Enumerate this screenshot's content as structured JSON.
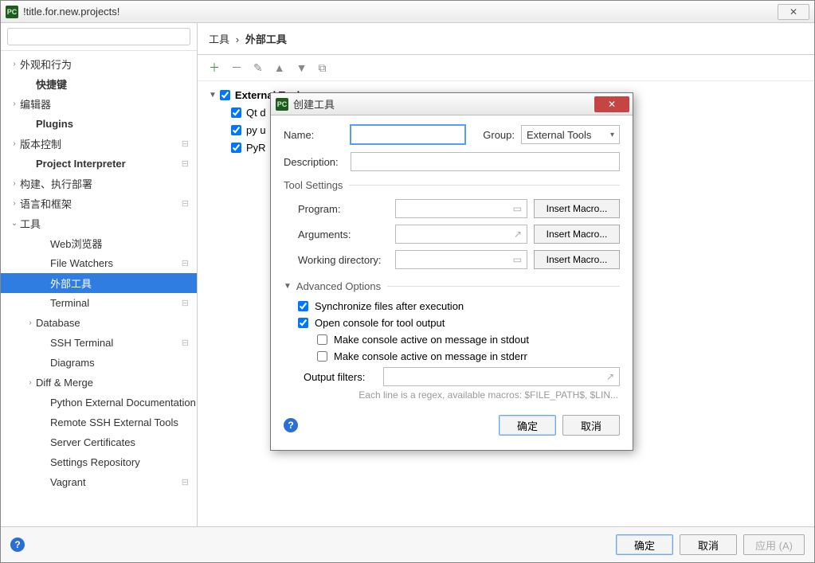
{
  "window": {
    "title": "!title.for.new.projects!"
  },
  "sidebar": {
    "search_placeholder": "",
    "items": [
      {
        "label": "外观和行为",
        "chev": "›",
        "bold": false,
        "indent": 0
      },
      {
        "label": "快捷键",
        "chev": "",
        "bold": true,
        "indent": 1
      },
      {
        "label": "编辑器",
        "chev": "›",
        "bold": false,
        "indent": 0
      },
      {
        "label": "Plugins",
        "chev": "",
        "bold": true,
        "indent": 1
      },
      {
        "label": "版本控制",
        "chev": "›",
        "bold": false,
        "indent": 0,
        "cfg": true
      },
      {
        "label": "Project Interpreter",
        "chev": "",
        "bold": true,
        "indent": 1,
        "cfg": true
      },
      {
        "label": "构建、执行部署",
        "chev": "›",
        "bold": false,
        "indent": 0
      },
      {
        "label": "语言和框架",
        "chev": "›",
        "bold": false,
        "indent": 0,
        "cfg": true
      },
      {
        "label": "工具",
        "chev": "⌄",
        "bold": false,
        "indent": 0
      },
      {
        "label": "Web浏览器",
        "chev": "",
        "bold": false,
        "indent": 2
      },
      {
        "label": "File Watchers",
        "chev": "",
        "bold": false,
        "indent": 2,
        "cfg": true
      },
      {
        "label": "外部工具",
        "chev": "",
        "bold": false,
        "indent": 2,
        "selected": true
      },
      {
        "label": "Terminal",
        "chev": "",
        "bold": false,
        "indent": 2,
        "cfg": true
      },
      {
        "label": "Database",
        "chev": "›",
        "bold": false,
        "indent": 1
      },
      {
        "label": "SSH Terminal",
        "chev": "",
        "bold": false,
        "indent": 2,
        "cfg": true
      },
      {
        "label": "Diagrams",
        "chev": "",
        "bold": false,
        "indent": 2
      },
      {
        "label": "Diff & Merge",
        "chev": "›",
        "bold": false,
        "indent": 1
      },
      {
        "label": "Python External Documentation",
        "chev": "",
        "bold": false,
        "indent": 2
      },
      {
        "label": "Remote SSH External Tools",
        "chev": "",
        "bold": false,
        "indent": 2
      },
      {
        "label": "Server Certificates",
        "chev": "",
        "bold": false,
        "indent": 2
      },
      {
        "label": "Settings Repository",
        "chev": "",
        "bold": false,
        "indent": 2
      },
      {
        "label": "Vagrant",
        "chev": "",
        "bold": false,
        "indent": 2,
        "cfg": true
      }
    ]
  },
  "breadcrumb": {
    "part1": "工具",
    "sep": "›",
    "part2": "外部工具"
  },
  "tools_tree": {
    "root": "External Tools",
    "children": [
      "Qt d",
      "py u",
      "PyR"
    ]
  },
  "dialog": {
    "title": "创建工具",
    "name_label": "Name:",
    "group_label": "Group:",
    "group_value": "External Tools",
    "desc_label": "Description:",
    "tool_settings": "Tool Settings",
    "program_label": "Program:",
    "arguments_label": "Arguments:",
    "workdir_label": "Working directory:",
    "insert_macro": "Insert Macro...",
    "advanced": "Advanced Options",
    "sync_label": "Synchronize files after execution",
    "console_label": "Open console for tool output",
    "stdout_label": "Make console active on message in stdout",
    "stderr_label": "Make console active on message in stderr",
    "filters_label": "Output filters:",
    "hint": "Each line is a regex, available macros: $FILE_PATH$, $LIN...",
    "ok": "确定",
    "cancel": "取消"
  },
  "bottom": {
    "ok": "确定",
    "cancel": "取消",
    "apply": "应用 (A)"
  }
}
